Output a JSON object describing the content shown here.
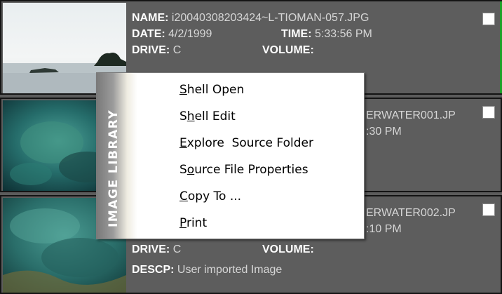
{
  "items": [
    {
      "name_label": "NAME:",
      "name": "i20040308203424~L-TIOMAN-057.JPG",
      "date_label": "DATE:",
      "date": "4/2/1999",
      "time_label": "TIME:",
      "time": "5:33:56 PM",
      "drive_label": "DRIVE:",
      "drive": "C",
      "volume_label": "VOLUME:"
    },
    {
      "name_partial": "ERWATER001.JP",
      "time_partial": ":30 PM"
    },
    {
      "name_partial": "ERWATER002.JP",
      "time_partial": ":10 PM",
      "drive_label": "DRIVE:",
      "drive": "C",
      "volume_label": "VOLUME:",
      "descp_label": "DESCP:",
      "descp": "User imported Image"
    }
  ],
  "context_menu": {
    "band_title": "IMAGE LIBRARY",
    "items": [
      {
        "pre": "",
        "key": "S",
        "post": "hell Open"
      },
      {
        "pre": "S",
        "key": "h",
        "post": "ell Edit"
      },
      {
        "pre": "",
        "key": "E",
        "post": "xplore  Source Folder"
      },
      {
        "pre": "S",
        "key": "o",
        "post": "urce File Properties"
      },
      {
        "pre": "",
        "key": "C",
        "post": "opy To ..."
      },
      {
        "pre": "",
        "key": "P",
        "post": "rint"
      }
    ]
  }
}
